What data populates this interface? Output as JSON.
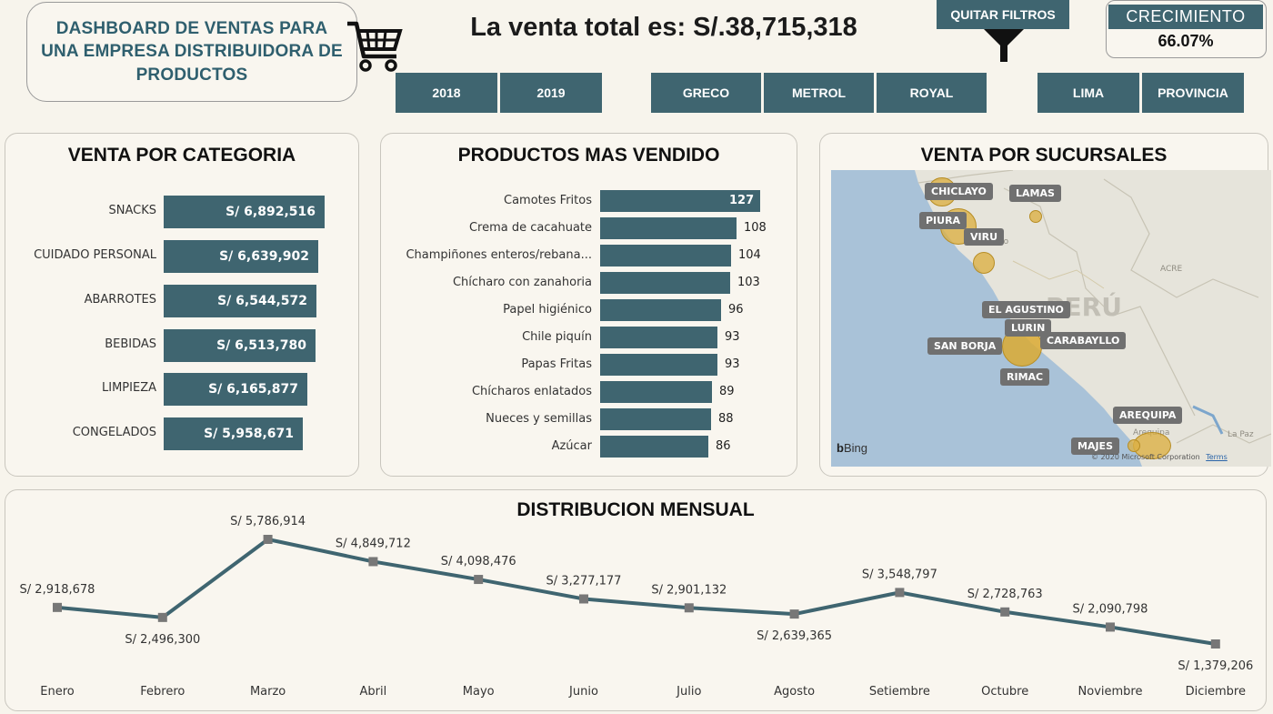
{
  "header": {
    "title": "DASHBOARD DE VENTAS PARA UNA EMPRESA DISTRIBUIDORA DE PRODUCTOS",
    "total_label": "La venta total es: S/.38,715,318",
    "quitar_filtros": "QUITAR FILTROS",
    "crecimiento_label": "CRECIMIENTO",
    "crecimiento_value": "66.07%"
  },
  "filters": {
    "years": [
      "2018",
      "2019"
    ],
    "brands": [
      "GRECO",
      "METROL",
      "ROYAL"
    ],
    "regions": [
      "LIMA",
      "PROVINCIA"
    ]
  },
  "categoria": {
    "title": "VENTA POR CATEGORIA",
    "items": [
      {
        "label": "SNACKS",
        "value": "S/ 6,892,516"
      },
      {
        "label": "CUIDADO PERSONAL",
        "value": "S/ 6,639,902"
      },
      {
        "label": "ABARROTES",
        "value": "S/ 6,544,572"
      },
      {
        "label": "BEBIDAS",
        "value": "S/ 6,513,780"
      },
      {
        "label": "LIMPIEZA",
        "value": "S/ 6,165,877"
      },
      {
        "label": "CONGELADOS",
        "value": "S/ 5,958,671"
      }
    ]
  },
  "productos": {
    "title": "PRODUCTOS MAS VENDIDO",
    "items": [
      {
        "label": "Camotes Fritos",
        "value": "127"
      },
      {
        "label": "Crema de cacahuate",
        "value": "108"
      },
      {
        "label": "Champiñones enteros/rebana...",
        "value": "104"
      },
      {
        "label": "Chícharo con zanahoria",
        "value": "103"
      },
      {
        "label": "Papel higiénico",
        "value": "96"
      },
      {
        "label": "Chile piquín",
        "value": "93"
      },
      {
        "label": "Papas Fritas",
        "value": "93"
      },
      {
        "label": "Chícharos enlatados",
        "value": "89"
      },
      {
        "label": "Nueces y semillas",
        "value": "88"
      },
      {
        "label": "Azúcar",
        "value": "86"
      }
    ]
  },
  "sucursales": {
    "title": "VENTA POR SUCURSALES",
    "labels": [
      "CHICLAYO",
      "LAMAS",
      "PIURA",
      "VIRU",
      "EL AGUSTINO",
      "LURIN",
      "CARABAYLLO",
      "SAN BORJA",
      "RIMAC",
      "AREQUIPA",
      "MAJES"
    ],
    "map_text": {
      "country": "PERÚ",
      "acre": "ACRE",
      "trujillo": "Trujillo",
      "arequipa_city": "Arequipa",
      "lapaz": "La Paz"
    },
    "bing": "Bing",
    "copyright": "© 2020 Microsoft Corporation",
    "terms": "Terms"
  },
  "mensual": {
    "title": "DISTRIBUCION MENSUAL"
  },
  "chart_data": {
    "type": "line",
    "categories": [
      "Enero",
      "Febrero",
      "Marzo",
      "Abril",
      "Mayo",
      "Junio",
      "Julio",
      "Agosto",
      "Setiembre",
      "Octubre",
      "Noviembre",
      "Diciembre"
    ],
    "values": [
      2918678,
      2496300,
      5786914,
      4849712,
      4098476,
      3277177,
      2901132,
      2639365,
      3548797,
      2728763,
      2090798,
      1379206
    ],
    "labels": [
      "S/ 2,918,678",
      "S/ 2,496,300",
      "S/ 5,786,914",
      "S/ 4,849,712",
      "S/ 4,098,476",
      "S/ 3,277,177",
      "S/ 2,901,132",
      "S/ 2,639,365",
      "S/ 3,548,797",
      "S/ 2,728,763",
      "S/ 2,090,798",
      "S/ 1,379,206"
    ],
    "title": "DISTRIBUCION MENSUAL",
    "line_color": "#3f6570"
  }
}
